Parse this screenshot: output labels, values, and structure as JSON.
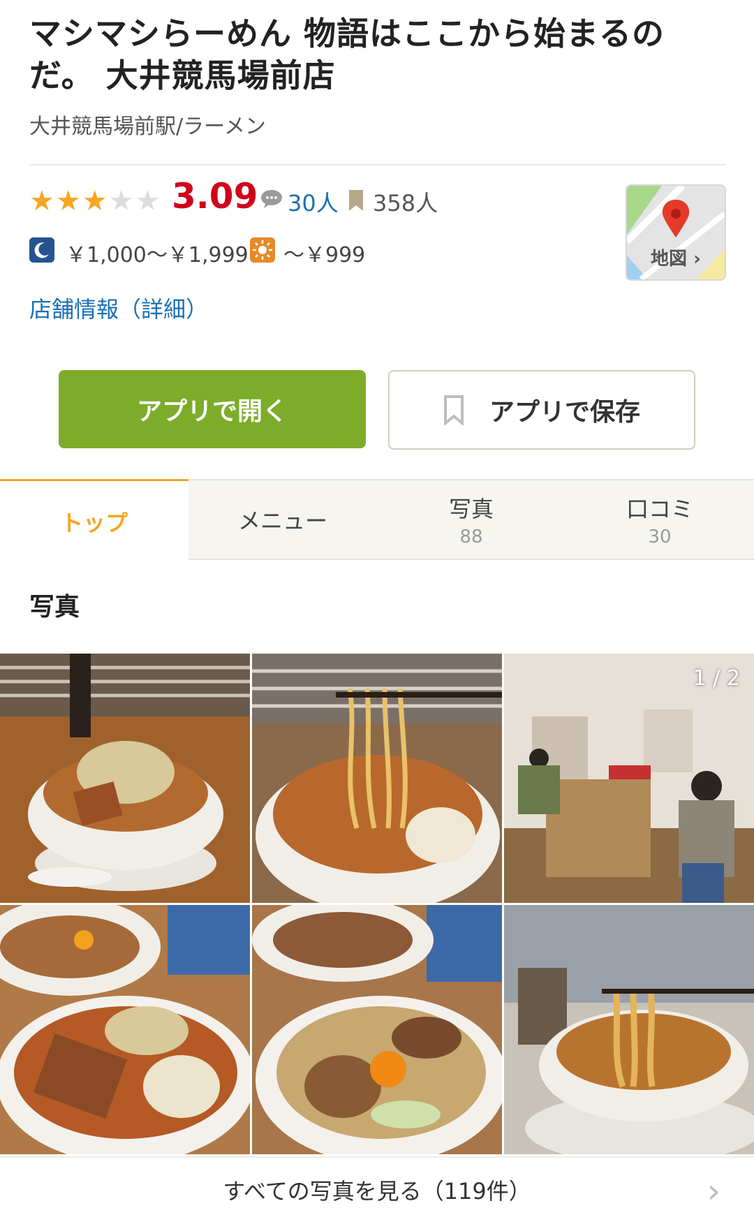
{
  "header": {
    "title": "マシマシらーめん 物語はここから始まるのだ。 大井競馬場前店",
    "subtitle": "大井競馬場前駅/ラーメン"
  },
  "rating": {
    "stars_filled": 3,
    "stars_total": 5,
    "score": "3.09",
    "review_count": "30人",
    "bookmark_count": "358人"
  },
  "prices": {
    "dinner": "￥1,000～￥1,999",
    "lunch": "～￥999"
  },
  "map": {
    "label": "地図"
  },
  "links": {
    "details": "店舗情報（詳細）"
  },
  "actions": {
    "open_app": "アプリで開く",
    "save_app": "アプリで保存"
  },
  "tabs": [
    {
      "label": "トップ",
      "count": ""
    },
    {
      "label": "メニュー",
      "count": ""
    },
    {
      "label": "写真",
      "count": "88"
    },
    {
      "label": "口コミ",
      "count": "30"
    }
  ],
  "photos": {
    "section_title": "写真",
    "counter": "1 / 2",
    "see_all": "すべての写真を見る（119件）"
  },
  "colors": {
    "accent_orange": "#f5a623",
    "score_red": "#d0021b",
    "link_blue": "#1a6fb5",
    "button_green": "#7cac2a"
  }
}
